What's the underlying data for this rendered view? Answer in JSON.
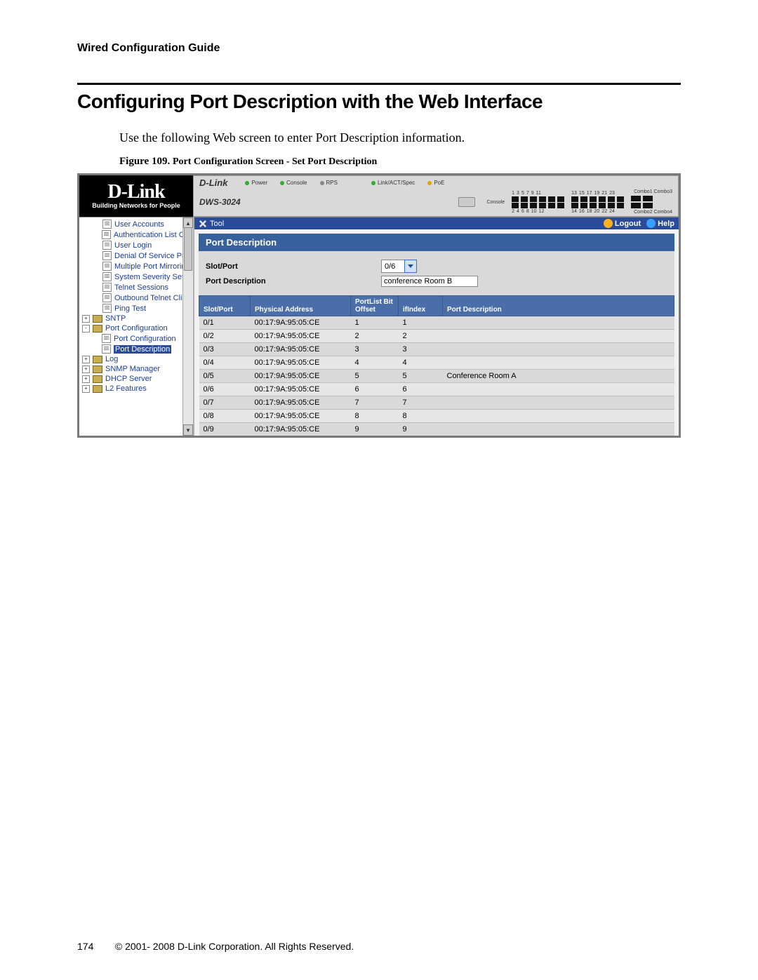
{
  "doc": {
    "running_head": "Wired Configuration Guide",
    "section_title": "Configuring Port Description with the Web Interface",
    "intro": "Use the following Web screen to enter Port Description information.",
    "figure_label": "Figure 109.",
    "figure_title": "Port Configuration Screen - Set Port Description",
    "page_number": "174",
    "copyright": "© 2001- 2008 D-Link Corporation. All Rights Reserved."
  },
  "logo": {
    "brand": "D-Link",
    "tagline": "Building Networks for People"
  },
  "device": {
    "brand": "D-Link",
    "model": "DWS-3024",
    "leds": [
      "Power",
      "Console",
      "RPS",
      "Link/ACT/Spec",
      "PoE"
    ],
    "port_numbers_top": [
      "1",
      "3",
      "5",
      "7",
      "9",
      "11",
      "13",
      "15",
      "17",
      "19",
      "21",
      "23"
    ],
    "port_numbers_bottom": [
      "2",
      "4",
      "6",
      "8",
      "10",
      "12",
      "14",
      "16",
      "18",
      "20",
      "22",
      "24"
    ],
    "console_label": "Console",
    "combo1": "Combo1 Combo3",
    "combo2": "Combo2 Combo4"
  },
  "toolbar": {
    "tool": "Tool",
    "logout": "Logout",
    "help": "Help"
  },
  "nav": {
    "items": [
      {
        "label": "User Accounts",
        "type": "doc",
        "indent": 1
      },
      {
        "label": "Authentication List Con",
        "type": "doc",
        "indent": 1
      },
      {
        "label": "User Login",
        "type": "doc",
        "indent": 1
      },
      {
        "label": "Denial Of Service Prot",
        "type": "doc",
        "indent": 1
      },
      {
        "label": "Multiple Port Mirroring",
        "type": "doc",
        "indent": 1
      },
      {
        "label": "System Severity Settin",
        "type": "doc",
        "indent": 1
      },
      {
        "label": "Telnet Sessions",
        "type": "doc",
        "indent": 1
      },
      {
        "label": "Outbound Telnet Clien",
        "type": "doc",
        "indent": 1
      },
      {
        "label": "Ping Test",
        "type": "doc",
        "indent": 1
      },
      {
        "label": "SNTP",
        "type": "fld",
        "indent": 0,
        "exp": "+"
      },
      {
        "label": "Port Configuration",
        "type": "fld",
        "indent": 0,
        "exp": "-"
      },
      {
        "label": "Port Configuration",
        "type": "doc",
        "indent": 2
      },
      {
        "label": "Port Description",
        "type": "doc",
        "indent": 2,
        "selected": true
      },
      {
        "label": "Log",
        "type": "fld",
        "indent": 0,
        "exp": "+"
      },
      {
        "label": "SNMP Manager",
        "type": "fld",
        "indent": 0,
        "exp": "+"
      },
      {
        "label": "DHCP Server",
        "type": "fld",
        "indent": 0,
        "exp": "+"
      },
      {
        "label": "L2 Features",
        "type": "fld",
        "indent": 0,
        "exp": "+"
      }
    ]
  },
  "page": {
    "title": "Port Description",
    "slot_port_label": "Slot/Port",
    "slot_port_value": "0/6",
    "desc_label": "Port Description",
    "desc_value": "conference Room B"
  },
  "table": {
    "headers": [
      "Slot/Port",
      "Physical Address",
      "PortList Bit Offset",
      "ifIndex",
      "Port Description"
    ],
    "rows": [
      [
        "0/1",
        "00:17:9A:95:05:CE",
        "1",
        "1",
        ""
      ],
      [
        "0/2",
        "00:17:9A:95:05:CE",
        "2",
        "2",
        ""
      ],
      [
        "0/3",
        "00:17:9A:95:05:CE",
        "3",
        "3",
        ""
      ],
      [
        "0/4",
        "00:17:9A:95:05:CE",
        "4",
        "4",
        ""
      ],
      [
        "0/5",
        "00:17:9A:95:05:CE",
        "5",
        "5",
        "Conference Room A"
      ],
      [
        "0/6",
        "00:17:9A:95:05:CE",
        "6",
        "6",
        ""
      ],
      [
        "0/7",
        "00:17:9A:95:05:CE",
        "7",
        "7",
        ""
      ],
      [
        "0/8",
        "00:17:9A:95:05:CE",
        "8",
        "8",
        ""
      ],
      [
        "0/9",
        "00:17:9A:95:05:CE",
        "9",
        "9",
        ""
      ]
    ]
  }
}
